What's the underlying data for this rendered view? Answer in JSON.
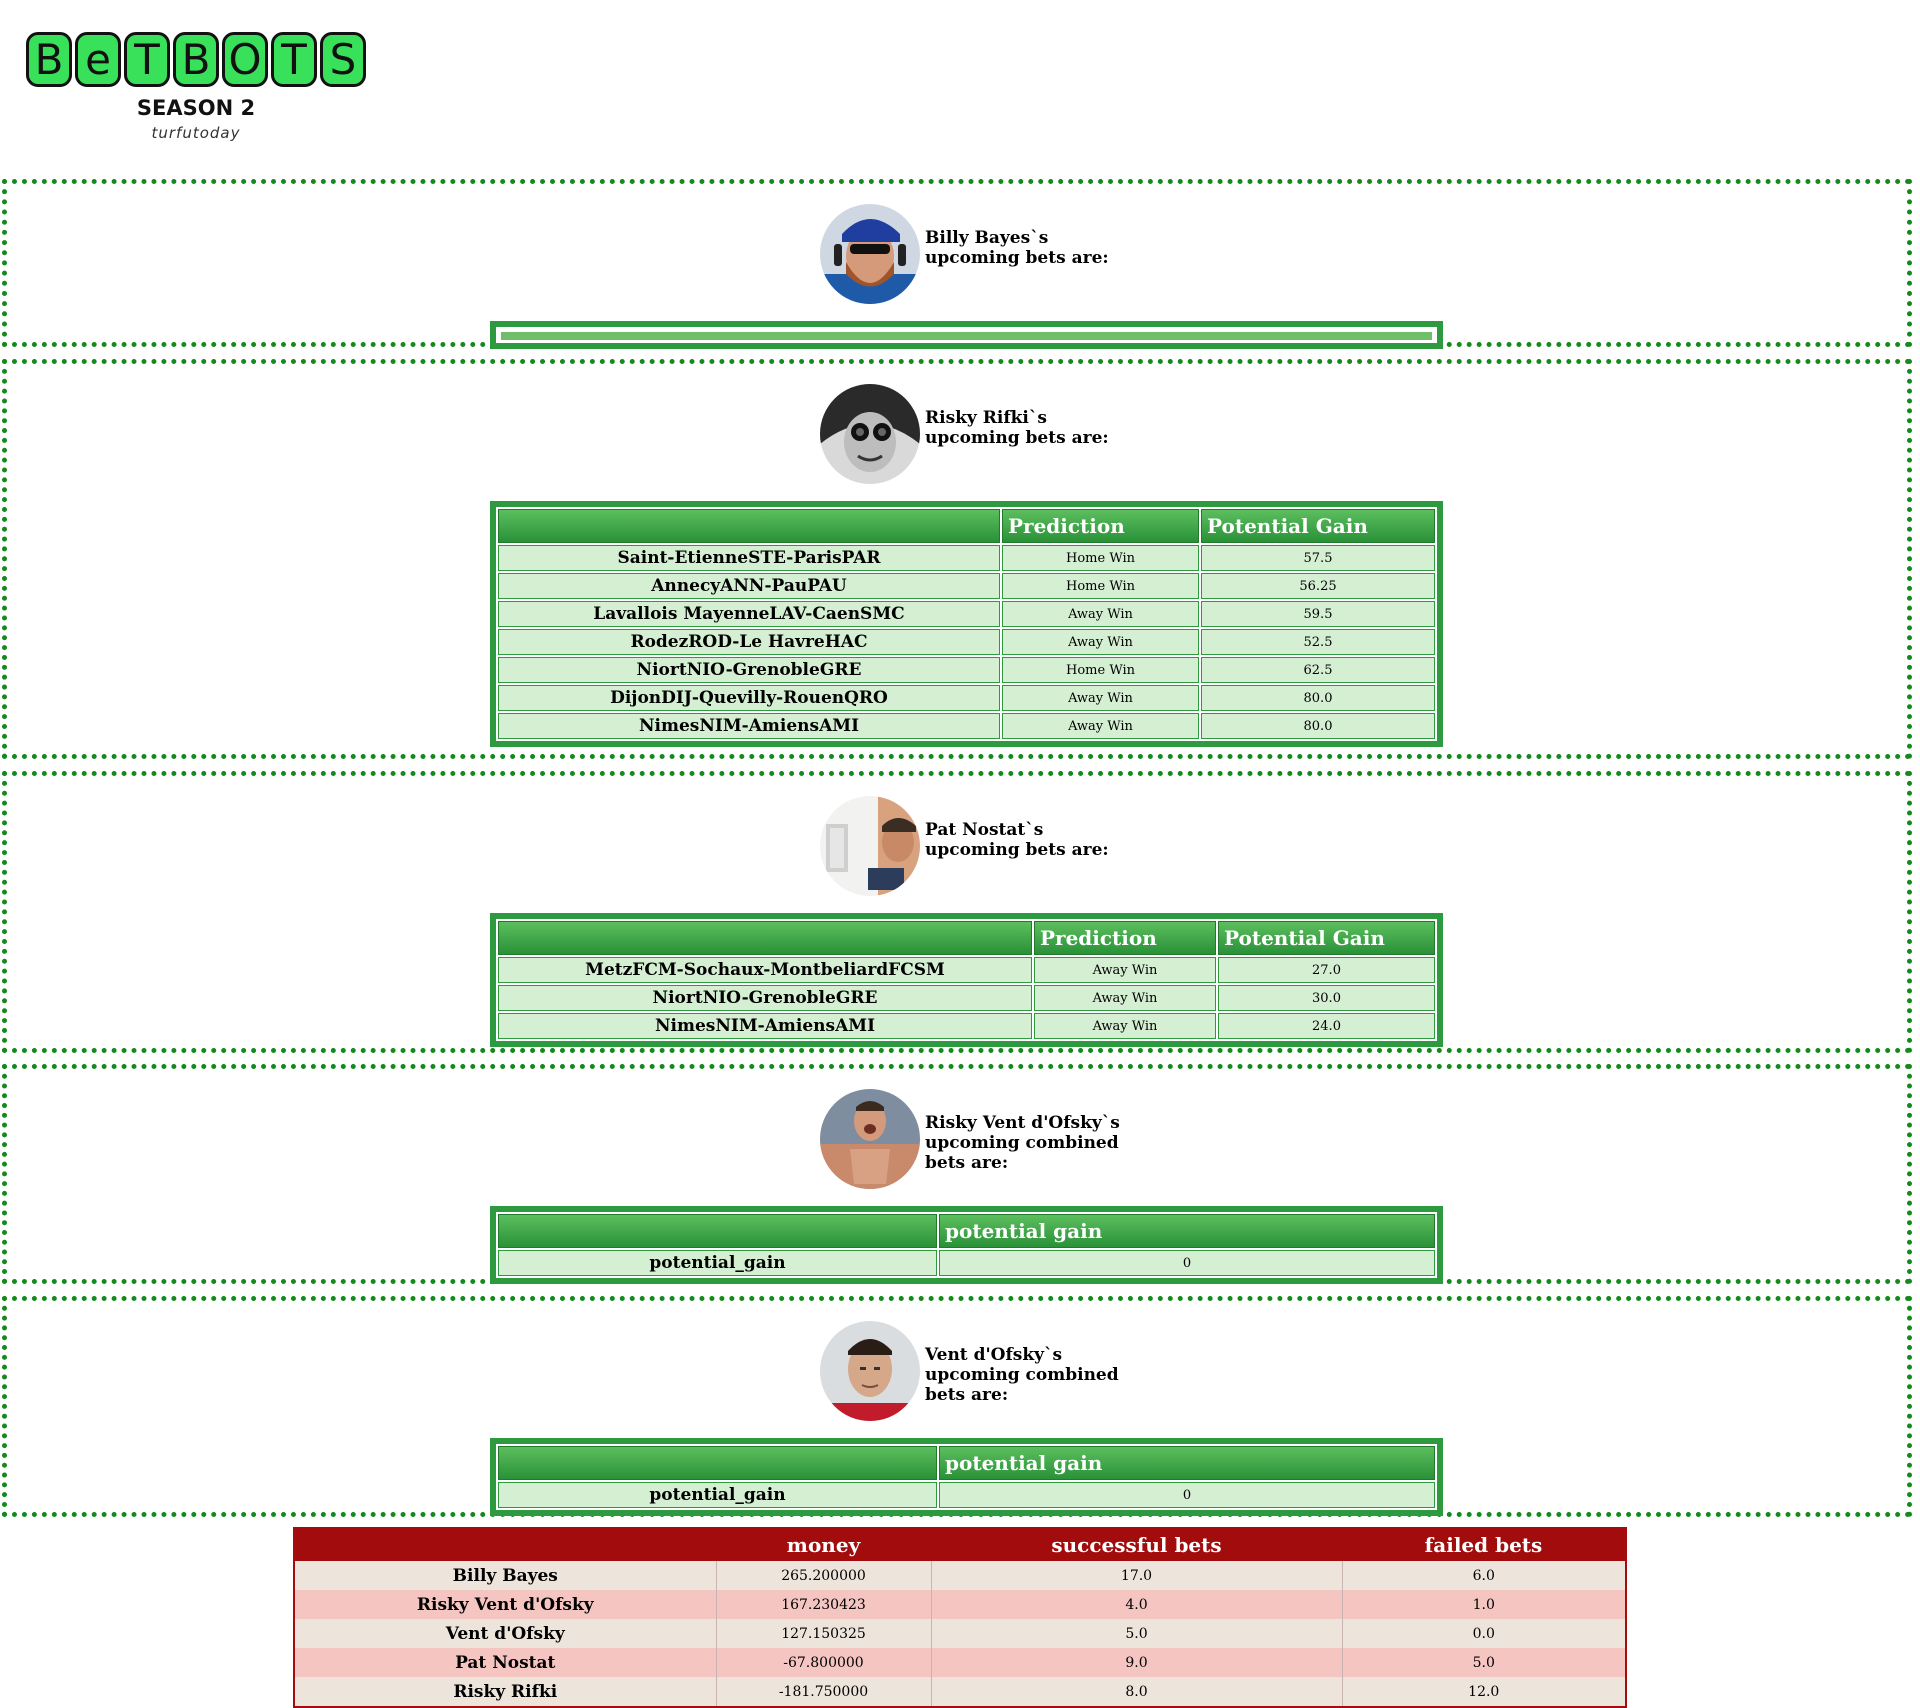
{
  "logo": {
    "letters": [
      "B",
      "e",
      "T",
      "B",
      "O",
      "T",
      "S"
    ],
    "season": "SEASON 2",
    "tagline": "turfutoday"
  },
  "sections": [
    {
      "bot_name": "Billy Bayes",
      "heading": "Billy Bayes`s upcoming bets are:",
      "table": "empty"
    },
    {
      "bot_name": "Risky Rifki",
      "heading": "Risky Rifki`s upcoming bets are:",
      "headers": [
        "",
        "Prediction",
        "Potential Gain"
      ],
      "rows": [
        [
          "Saint-EtienneSTE-ParisPAR",
          "Home Win",
          "57.5"
        ],
        [
          "AnnecyANN-PauPAU",
          "Home Win",
          "56.25"
        ],
        [
          "Lavallois MayenneLAV-CaenSMC",
          "Away Win",
          "59.5"
        ],
        [
          "RodezROD-Le HavreHAC",
          "Away Win",
          "52.5"
        ],
        [
          "NiortNIO-GrenobleGRE",
          "Home Win",
          "62.5"
        ],
        [
          "DijonDIJ-Quevilly-RouenQRO",
          "Away Win",
          "80.0"
        ],
        [
          "NimesNIM-AmiensAMI",
          "Away Win",
          "80.0"
        ]
      ]
    },
    {
      "bot_name": "Pat Nostat",
      "heading": "Pat Nostat`s upcoming bets are:",
      "headers": [
        "",
        "Prediction",
        "Potential Gain"
      ],
      "rows": [
        [
          "MetzFCM-Sochaux-MontbeliardFCSM",
          "Away Win",
          "27.0"
        ],
        [
          "NiortNIO-GrenobleGRE",
          "Away Win",
          "30.0"
        ],
        [
          "NimesNIM-AmiensAMI",
          "Away Win",
          "24.0"
        ]
      ]
    },
    {
      "bot_name": "Risky Vent d'Ofsky",
      "heading": "Risky Vent d'Ofsky`s upcoming combined bets are:",
      "headers": [
        "",
        "potential gain"
      ],
      "rows": [
        [
          "potential_gain",
          "0"
        ]
      ]
    },
    {
      "bot_name": "Vent d'Ofsky",
      "heading": "Vent d'Ofsky`s upcoming combined bets are:",
      "headers": [
        "",
        "potential gain"
      ],
      "rows": [
        [
          "potential_gain",
          "0"
        ]
      ]
    }
  ],
  "leaderboard": {
    "headers": [
      "",
      "money",
      "successful bets",
      "failed bets"
    ],
    "rows": [
      [
        "Billy Bayes",
        "265.200000",
        "17.0",
        "6.0"
      ],
      [
        "Risky Vent d'Ofsky",
        "167.230423",
        "4.0",
        "1.0"
      ],
      [
        "Vent d'Ofsky",
        "127.150325",
        "5.0",
        "0.0"
      ],
      [
        "Pat Nostat",
        "-67.800000",
        "9.0",
        "5.0"
      ],
      [
        "Risky Rifki",
        "-181.750000",
        "8.0",
        "12.0"
      ]
    ]
  },
  "colors": {
    "section_border": "#138a1a",
    "table_header": "#2a9138",
    "table_cell": "#d5efd3",
    "leaderboard_header": "#a20c0c",
    "leaderboard_odd": "#ede4dc",
    "leaderboard_even": "#f4c5c1",
    "logo_green": "#39e05a"
  }
}
